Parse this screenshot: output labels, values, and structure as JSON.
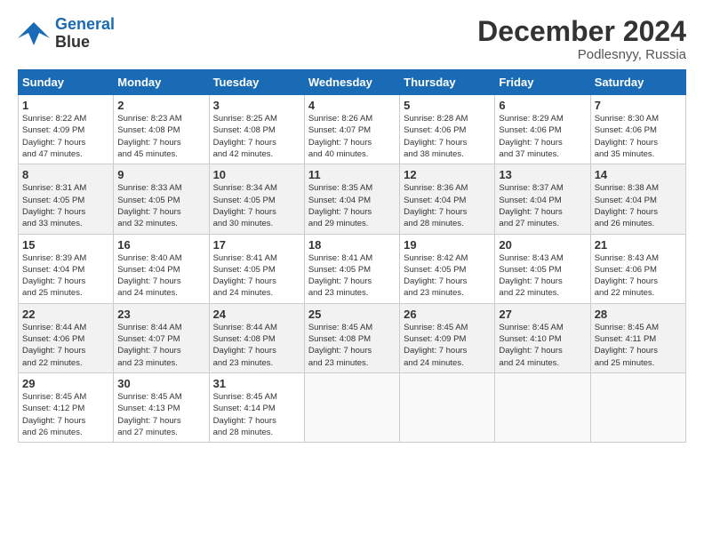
{
  "logo": {
    "line1": "General",
    "line2": "Blue"
  },
  "title": "December 2024",
  "subtitle": "Podlesnyy, Russia",
  "days_of_week": [
    "Sunday",
    "Monday",
    "Tuesday",
    "Wednesday",
    "Thursday",
    "Friday",
    "Saturday"
  ],
  "weeks": [
    [
      {
        "day": "1",
        "info": "Sunrise: 8:22 AM\nSunset: 4:09 PM\nDaylight: 7 hours\nand 47 minutes."
      },
      {
        "day": "2",
        "info": "Sunrise: 8:23 AM\nSunset: 4:08 PM\nDaylight: 7 hours\nand 45 minutes."
      },
      {
        "day": "3",
        "info": "Sunrise: 8:25 AM\nSunset: 4:08 PM\nDaylight: 7 hours\nand 42 minutes."
      },
      {
        "day": "4",
        "info": "Sunrise: 8:26 AM\nSunset: 4:07 PM\nDaylight: 7 hours\nand 40 minutes."
      },
      {
        "day": "5",
        "info": "Sunrise: 8:28 AM\nSunset: 4:06 PM\nDaylight: 7 hours\nand 38 minutes."
      },
      {
        "day": "6",
        "info": "Sunrise: 8:29 AM\nSunset: 4:06 PM\nDaylight: 7 hours\nand 37 minutes."
      },
      {
        "day": "7",
        "info": "Sunrise: 8:30 AM\nSunset: 4:06 PM\nDaylight: 7 hours\nand 35 minutes."
      }
    ],
    [
      {
        "day": "8",
        "info": "Sunrise: 8:31 AM\nSunset: 4:05 PM\nDaylight: 7 hours\nand 33 minutes."
      },
      {
        "day": "9",
        "info": "Sunrise: 8:33 AM\nSunset: 4:05 PM\nDaylight: 7 hours\nand 32 minutes."
      },
      {
        "day": "10",
        "info": "Sunrise: 8:34 AM\nSunset: 4:05 PM\nDaylight: 7 hours\nand 30 minutes."
      },
      {
        "day": "11",
        "info": "Sunrise: 8:35 AM\nSunset: 4:04 PM\nDaylight: 7 hours\nand 29 minutes."
      },
      {
        "day": "12",
        "info": "Sunrise: 8:36 AM\nSunset: 4:04 PM\nDaylight: 7 hours\nand 28 minutes."
      },
      {
        "day": "13",
        "info": "Sunrise: 8:37 AM\nSunset: 4:04 PM\nDaylight: 7 hours\nand 27 minutes."
      },
      {
        "day": "14",
        "info": "Sunrise: 8:38 AM\nSunset: 4:04 PM\nDaylight: 7 hours\nand 26 minutes."
      }
    ],
    [
      {
        "day": "15",
        "info": "Sunrise: 8:39 AM\nSunset: 4:04 PM\nDaylight: 7 hours\nand 25 minutes."
      },
      {
        "day": "16",
        "info": "Sunrise: 8:40 AM\nSunset: 4:04 PM\nDaylight: 7 hours\nand 24 minutes."
      },
      {
        "day": "17",
        "info": "Sunrise: 8:41 AM\nSunset: 4:05 PM\nDaylight: 7 hours\nand 24 minutes."
      },
      {
        "day": "18",
        "info": "Sunrise: 8:41 AM\nSunset: 4:05 PM\nDaylight: 7 hours\nand 23 minutes."
      },
      {
        "day": "19",
        "info": "Sunrise: 8:42 AM\nSunset: 4:05 PM\nDaylight: 7 hours\nand 23 minutes."
      },
      {
        "day": "20",
        "info": "Sunrise: 8:43 AM\nSunset: 4:05 PM\nDaylight: 7 hours\nand 22 minutes."
      },
      {
        "day": "21",
        "info": "Sunrise: 8:43 AM\nSunset: 4:06 PM\nDaylight: 7 hours\nand 22 minutes."
      }
    ],
    [
      {
        "day": "22",
        "info": "Sunrise: 8:44 AM\nSunset: 4:06 PM\nDaylight: 7 hours\nand 22 minutes."
      },
      {
        "day": "23",
        "info": "Sunrise: 8:44 AM\nSunset: 4:07 PM\nDaylight: 7 hours\nand 23 minutes."
      },
      {
        "day": "24",
        "info": "Sunrise: 8:44 AM\nSunset: 4:08 PM\nDaylight: 7 hours\nand 23 minutes."
      },
      {
        "day": "25",
        "info": "Sunrise: 8:45 AM\nSunset: 4:08 PM\nDaylight: 7 hours\nand 23 minutes."
      },
      {
        "day": "26",
        "info": "Sunrise: 8:45 AM\nSunset: 4:09 PM\nDaylight: 7 hours\nand 24 minutes."
      },
      {
        "day": "27",
        "info": "Sunrise: 8:45 AM\nSunset: 4:10 PM\nDaylight: 7 hours\nand 24 minutes."
      },
      {
        "day": "28",
        "info": "Sunrise: 8:45 AM\nSunset: 4:11 PM\nDaylight: 7 hours\nand 25 minutes."
      }
    ],
    [
      {
        "day": "29",
        "info": "Sunrise: 8:45 AM\nSunset: 4:12 PM\nDaylight: 7 hours\nand 26 minutes."
      },
      {
        "day": "30",
        "info": "Sunrise: 8:45 AM\nSunset: 4:13 PM\nDaylight: 7 hours\nand 27 minutes."
      },
      {
        "day": "31",
        "info": "Sunrise: 8:45 AM\nSunset: 4:14 PM\nDaylight: 7 hours\nand 28 minutes."
      },
      null,
      null,
      null,
      null
    ]
  ]
}
